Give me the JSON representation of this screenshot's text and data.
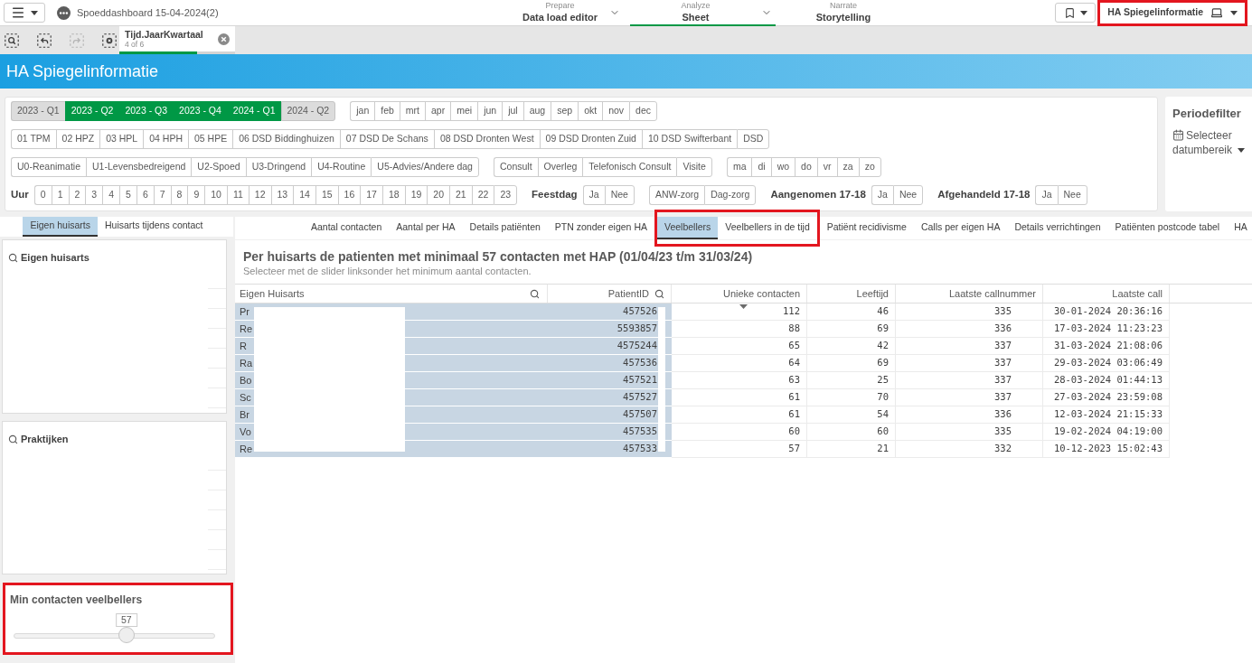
{
  "toolbar": {
    "app_title": "Spoeddashboard 15-04-2024(2)",
    "nav": [
      {
        "caption": "Prepare",
        "label": "Data load editor",
        "selected": false,
        "dropdown": true
      },
      {
        "caption": "Analyze",
        "label": "Sheet",
        "selected": true,
        "dropdown": true
      },
      {
        "caption": "Narrate",
        "label": "Storytelling",
        "selected": false,
        "dropdown": false
      }
    ],
    "sheet_selector": {
      "label": "HA Spiegelinformatie",
      "highlighted": true
    }
  },
  "selection_tools": [
    {
      "kind": "search",
      "disabled": false
    },
    {
      "kind": "back",
      "disabled": false
    },
    {
      "kind": "forward",
      "disabled": true
    },
    {
      "kind": "clear",
      "disabled": false
    }
  ],
  "selections": [
    {
      "field": "Tijd.JaarKwartaal",
      "count": "4 of 6",
      "level": 0.67
    }
  ],
  "sheet_title": "HA Spiegelinformatie",
  "filter_rows": [
    [
      {
        "options": [
          {
            "label": "2023 - Q1",
            "selected": false,
            "excluded": true
          },
          {
            "label": "2023 - Q2",
            "selected": true,
            "excluded": false
          },
          {
            "label": "2023 - Q3",
            "selected": true,
            "excluded": false
          },
          {
            "label": "2023 - Q4",
            "selected": true,
            "excluded": false
          },
          {
            "label": "2024 - Q1",
            "selected": true,
            "excluded": false
          },
          {
            "label": "2024 - Q2",
            "selected": false,
            "excluded": true
          }
        ]
      },
      {
        "options": [
          {
            "label": "jan",
            "selected": false,
            "excluded": false
          },
          {
            "label": "feb",
            "selected": false,
            "excluded": false
          },
          {
            "label": "mrt",
            "selected": false,
            "excluded": false
          },
          {
            "label": "apr",
            "selected": false,
            "excluded": false
          },
          {
            "label": "mei",
            "selected": false,
            "excluded": false
          },
          {
            "label": "jun",
            "selected": false,
            "excluded": false
          },
          {
            "label": "jul",
            "selected": false,
            "excluded": false
          },
          {
            "label": "aug",
            "selected": false,
            "excluded": false
          },
          {
            "label": "sep",
            "selected": false,
            "excluded": false
          },
          {
            "label": "okt",
            "selected": false,
            "excluded": false
          },
          {
            "label": "nov",
            "selected": false,
            "excluded": false
          },
          {
            "label": "dec",
            "selected": false,
            "excluded": false
          }
        ]
      }
    ],
    [
      {
        "options": [
          {
            "label": "01 TPM",
            "selected": false,
            "excluded": false
          },
          {
            "label": "02 HPZ",
            "selected": false,
            "excluded": false
          },
          {
            "label": "03 HPL",
            "selected": false,
            "excluded": false
          },
          {
            "label": "04 HPH",
            "selected": false,
            "excluded": false
          },
          {
            "label": "05 HPE",
            "selected": false,
            "excluded": false
          },
          {
            "label": "06 DSD Biddinghuizen",
            "selected": false,
            "excluded": false
          },
          {
            "label": "07 DSD De Schans",
            "selected": false,
            "excluded": false
          },
          {
            "label": "08 DSD Dronten West",
            "selected": false,
            "excluded": false
          },
          {
            "label": "09 DSD Dronten Zuid",
            "selected": false,
            "excluded": false
          },
          {
            "label": "10 DSD Swifterbant",
            "selected": false,
            "excluded": false
          },
          {
            "label": "DSD",
            "selected": false,
            "excluded": false
          }
        ]
      }
    ],
    [
      {
        "options": [
          {
            "label": "U0-Reanimatie",
            "selected": false,
            "excluded": false
          },
          {
            "label": "U1-Levensbedreigend",
            "selected": false,
            "excluded": false
          },
          {
            "label": "U2-Spoed",
            "selected": false,
            "excluded": false
          },
          {
            "label": "U3-Dringend",
            "selected": false,
            "excluded": false
          },
          {
            "label": "U4-Routine",
            "selected": false,
            "excluded": false
          },
          {
            "label": "U5-Advies/Andere dag",
            "selected": false,
            "excluded": false
          }
        ]
      },
      {
        "options": [
          {
            "label": "Consult",
            "selected": false,
            "excluded": false
          },
          {
            "label": "Overleg",
            "selected": false,
            "excluded": false
          },
          {
            "label": "Telefonisch Consult",
            "selected": false,
            "excluded": false
          },
          {
            "label": "Visite",
            "selected": false,
            "excluded": false
          }
        ]
      },
      {
        "options": [
          {
            "label": "ma",
            "selected": false,
            "excluded": false
          },
          {
            "label": "di",
            "selected": false,
            "excluded": false
          },
          {
            "label": "wo",
            "selected": false,
            "excluded": false
          },
          {
            "label": "do",
            "selected": false,
            "excluded": false
          },
          {
            "label": "vr",
            "selected": false,
            "excluded": false
          },
          {
            "label": "za",
            "selected": false,
            "excluded": false
          },
          {
            "label": "zo",
            "selected": false,
            "excluded": false
          }
        ]
      }
    ],
    [
      {
        "label": "Uur",
        "options": [
          {
            "label": "0",
            "selected": false,
            "excluded": false
          },
          {
            "label": "1",
            "selected": false,
            "excluded": false
          },
          {
            "label": "2",
            "selected": false,
            "excluded": false
          },
          {
            "label": "3",
            "selected": false,
            "excluded": false
          },
          {
            "label": "4",
            "selected": false,
            "excluded": false
          },
          {
            "label": "5",
            "selected": false,
            "excluded": false
          },
          {
            "label": "6",
            "selected": false,
            "excluded": false
          },
          {
            "label": "7",
            "selected": false,
            "excluded": false
          },
          {
            "label": "8",
            "selected": false,
            "excluded": false
          },
          {
            "label": "9",
            "selected": false,
            "excluded": false
          },
          {
            "label": "10",
            "selected": false,
            "excluded": false
          },
          {
            "label": "11",
            "selected": false,
            "excluded": false
          },
          {
            "label": "12",
            "selected": false,
            "excluded": false
          },
          {
            "label": "13",
            "selected": false,
            "excluded": false
          },
          {
            "label": "14",
            "selected": false,
            "excluded": false
          },
          {
            "label": "15",
            "selected": false,
            "excluded": false
          },
          {
            "label": "16",
            "selected": false,
            "excluded": false
          },
          {
            "label": "17",
            "selected": false,
            "excluded": false
          },
          {
            "label": "18",
            "selected": false,
            "excluded": false
          },
          {
            "label": "19",
            "selected": false,
            "excluded": false
          },
          {
            "label": "20",
            "selected": false,
            "excluded": false
          },
          {
            "label": "21",
            "selected": false,
            "excluded": false
          },
          {
            "label": "22",
            "selected": false,
            "excluded": false
          },
          {
            "label": "23",
            "selected": false,
            "excluded": false
          }
        ]
      },
      {
        "label": "Feestdag",
        "options": [
          {
            "label": "Ja",
            "selected": false,
            "excluded": false
          },
          {
            "label": "Nee",
            "selected": false,
            "excluded": false
          }
        ]
      },
      {
        "options": [
          {
            "label": "ANW-zorg",
            "selected": false,
            "excluded": false
          },
          {
            "label": "Dag-zorg",
            "selected": false,
            "excluded": false
          }
        ]
      },
      {
        "label": "Aangenomen 17-18",
        "options": [
          {
            "label": "Ja",
            "selected": false,
            "excluded": false
          },
          {
            "label": "Nee",
            "selected": false,
            "excluded": false
          }
        ]
      },
      {
        "label": "Afgehandeld 17-18",
        "options": [
          {
            "label": "Ja",
            "selected": false,
            "excluded": false
          },
          {
            "label": "Nee",
            "selected": false,
            "excluded": false
          }
        ]
      }
    ]
  ],
  "period_filter": {
    "title": "Periodefilter",
    "button": "Selecteer datumbereik"
  },
  "left_tabs": [
    {
      "label": "Eigen huisarts",
      "selected": true
    },
    {
      "label": "Huisarts tijdens contact",
      "selected": false
    }
  ],
  "listboxes": [
    {
      "title": "Eigen huisarts"
    },
    {
      "title": "Praktijken"
    }
  ],
  "slider": {
    "title": "Min contacten veelbellers",
    "value": "57",
    "level": 0.56,
    "highlighted": true
  },
  "sheet_tabs": [
    {
      "label": "Aantal contacten",
      "selected": false,
      "highlighted": false
    },
    {
      "label": "Aantal per HA",
      "selected": false,
      "highlighted": false
    },
    {
      "label": "Details patiënten",
      "selected": false,
      "highlighted": false
    },
    {
      "label": "PTN zonder eigen HA",
      "selected": false,
      "highlighted": false
    },
    {
      "label": "Veelbellers",
      "selected": true,
      "highlighted": true
    },
    {
      "label": "Veelbellers in de tijd",
      "selected": false,
      "highlighted": true
    },
    {
      "label": "Patiënt recidivisme",
      "selected": false,
      "highlighted": false
    },
    {
      "label": "Calls per eigen HA",
      "selected": false,
      "highlighted": false
    },
    {
      "label": "Details verrichtingen",
      "selected": false,
      "highlighted": false
    },
    {
      "label": "Patiënten postcode tabel",
      "selected": false,
      "highlighted": false
    },
    {
      "label": "HA",
      "selected": false,
      "highlighted": false
    }
  ],
  "table": {
    "title": "Per huisarts de patienten met minimaal 57 contacten met HAP (01/04/23 t/m 31/03/24)",
    "subtitle": "Selecteer met de slider linksonder het minimum aantal contacten.",
    "columns": [
      {
        "label": "Eigen Huisarts",
        "search": true,
        "sorted": false,
        "shaded": true,
        "numeric": false
      },
      {
        "label": "PatientID",
        "search": true,
        "sorted": false,
        "shaded": true,
        "numeric": true
      },
      {
        "label": "Unieke contacten",
        "search": false,
        "sorted": true,
        "shaded": false,
        "numeric": true
      },
      {
        "label": "Leeftijd",
        "search": false,
        "sorted": false,
        "shaded": false,
        "numeric": true
      },
      {
        "label": "Laatste callnummer",
        "search": false,
        "sorted": false,
        "shaded": false,
        "numeric": true
      },
      {
        "label": "Laatste call",
        "search": false,
        "sorted": false,
        "shaded": false,
        "numeric": true
      }
    ],
    "rows": [
      [
        "Pr",
        "457526",
        "112",
        "46",
        "335",
        "30-01-2024 20:36:16"
      ],
      [
        "Re",
        "5593857",
        "88",
        "69",
        "336",
        "17-03-2024 11:23:23"
      ],
      [
        "R",
        "4575244",
        "65",
        "42",
        "337",
        "31-03-2024 21:08:06"
      ],
      [
        "Ra",
        "457536",
        "64",
        "69",
        "337",
        "29-03-2024 03:06:49"
      ],
      [
        "Bo",
        "457521",
        "63",
        "25",
        "337",
        "28-03-2024 01:44:13"
      ],
      [
        "Sc",
        "457527",
        "61",
        "70",
        "337",
        "27-03-2024 23:59:08"
      ],
      [
        "Br",
        "457507",
        "61",
        "54",
        "336",
        "12-03-2024 21:15:33"
      ],
      [
        "Vo",
        "457535",
        "60",
        "60",
        "335",
        "19-02-2024 04:19:00"
      ],
      [
        "Re",
        "457533",
        "57",
        "21",
        "332",
        "10-12-2023 15:02:43"
      ]
    ]
  }
}
